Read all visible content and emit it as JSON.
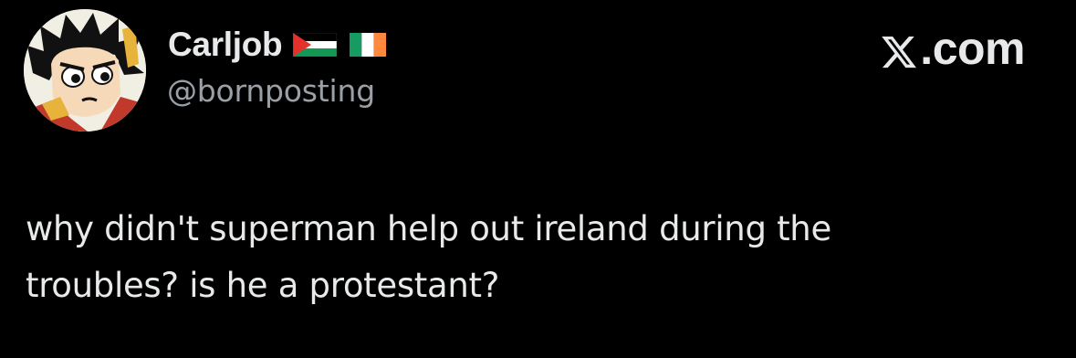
{
  "author": {
    "display_name": "Carljob",
    "handle": "@bornposting",
    "flags": [
      "palestine-flag",
      "ireland-flag"
    ],
    "avatar": "anime-character-avatar"
  },
  "brand": {
    "label": ".com",
    "logo": "x-logo-icon"
  },
  "tweet": {
    "lines": [
      "why didn't superman help out ireland during the",
      "troubles? is he a protestant?"
    ]
  },
  "colors": {
    "background": "#000000",
    "text_primary": "#e7e9ea",
    "text_secondary": "#9aa0a6"
  }
}
